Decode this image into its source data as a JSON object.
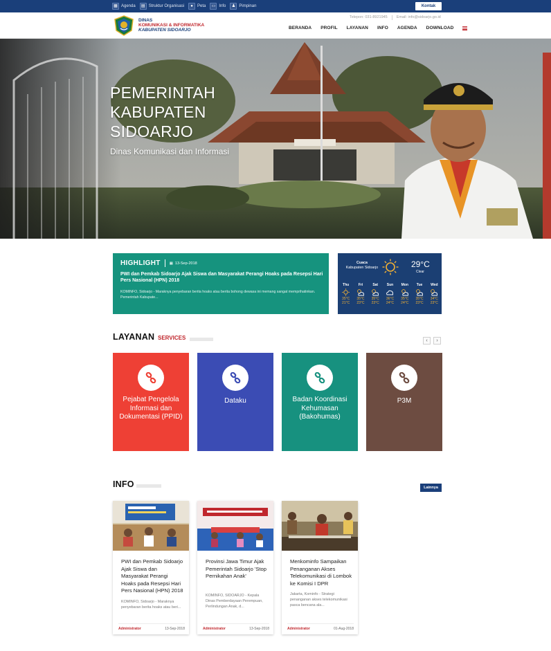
{
  "topbar": {
    "links": [
      {
        "label": "Agenda",
        "icon": "calendar-icon"
      },
      {
        "label": "Struktur Organisasi",
        "icon": "org-chart-icon"
      },
      {
        "label": "Peta",
        "icon": "map-pin-icon"
      },
      {
        "label": "Info",
        "icon": "info-icon"
      },
      {
        "label": "Pimpinan",
        "icon": "user-icon"
      }
    ],
    "kontak": "Kontak"
  },
  "header": {
    "logo_line1": "DINAS",
    "logo_line2": "KOMUNIKASI & INFORMATIKA",
    "logo_line3": "KABUPATEN SIDOARJO",
    "phone": "Telepon: 031-8921945",
    "email": "Email: info@sidoarjo.go.id",
    "nav": [
      "BERANDA",
      "PROFIL",
      "LAYANAN",
      "INFO",
      "AGENDA",
      "DOWNLOAD"
    ]
  },
  "hero": {
    "title_line1": "PEMERINTAH",
    "title_line2": "KABUPATEN",
    "title_line3": "SIDOARJO",
    "subtitle": "Dinas Komunikasi dan Informasi"
  },
  "highlight": {
    "label": "HIGHLIGHT",
    "date": "13-Sep-2018",
    "title": "PWI dan Pemkab Sidoarjo Ajak Siswa dan Masyarakat Perangi Hoaks pada Resepsi Hari Pers Nasional (HPN) 2018",
    "excerpt": "KOMINFO, Sidoarjo - Maraknya penyebaran berita hoaks atau berita bohong dewasa ini memang sangat memprihatinkan. Pemerintah Kabupate..."
  },
  "weather": {
    "label": "Cuaca",
    "city": "Kabupaten Sidoarjo",
    "temp": "29°C",
    "condition": "Clear",
    "days": [
      {
        "name": "Thu",
        "icon": "sun-icon",
        "high": "35°C",
        "low": "21°C"
      },
      {
        "name": "Fri",
        "icon": "partly-cloudy-icon",
        "high": "35°C",
        "low": "23°C"
      },
      {
        "name": "Sat",
        "icon": "partly-cloudy-icon",
        "high": "35°C",
        "low": "23°C"
      },
      {
        "name": "Sun",
        "icon": "cloud-icon",
        "high": "36°C",
        "low": "24°C"
      },
      {
        "name": "Mon",
        "icon": "partly-cloudy-icon",
        "high": "35°C",
        "low": "24°C"
      },
      {
        "name": "Tue",
        "icon": "partly-cloudy-icon",
        "high": "35°C",
        "low": "23°C"
      },
      {
        "name": "Wed",
        "icon": "partly-cloudy-icon",
        "high": "34°C",
        "low": "23°C"
      }
    ]
  },
  "layanan": {
    "title": "LAYANAN",
    "subtitle": "SERVICES",
    "prev": "‹",
    "next": "›",
    "items": [
      {
        "label": "Pejabat Pengelola Informasi dan Dokumentasi (PPID)",
        "color": "#ee4035"
      },
      {
        "label": "Dataku",
        "color": "#3b4cb4"
      },
      {
        "label": "Badan Koordinasi Kehumasan (Bakohumas)",
        "color": "#17917f"
      },
      {
        "label": "P3M",
        "color": "#6d4c41"
      }
    ]
  },
  "info": {
    "title": "INFO",
    "more": "Lainnya",
    "items": [
      {
        "title": "PWI dan Pemkab Sidoarjo Ajak Siswa dan Masyarakat Perangi Hoaks pada Resepsi Hari Pers Nasional (HPN) 2018",
        "excerpt": "KOMINFO, Sidoarjo - Maraknya penyebaran berita hoaks atau beri...",
        "author": "Administrator",
        "date": "13-Sep-2018"
      },
      {
        "title": "Provinsi Jawa Timur Ajak Pemerintah Sidoarjo 'Stop Pernikahan Anak'",
        "excerpt": "KOMINFO, SIDOARJO - Kepala Dinas Pemberdayaan Perempuan, Perlindungan Anak, d...",
        "author": "Administrator",
        "date": "13-Sep-2018"
      },
      {
        "title": "Menkominfo Sampaikan Penanganan Akses Telekomunikasi di Lombok ke Komisi I DPR",
        "excerpt": "Jakarta, Kominfo - Strategi penanganan akses telekomunikasi pasca bencana ala...",
        "author": "Administrator",
        "date": "01-Aug-2018"
      }
    ]
  }
}
